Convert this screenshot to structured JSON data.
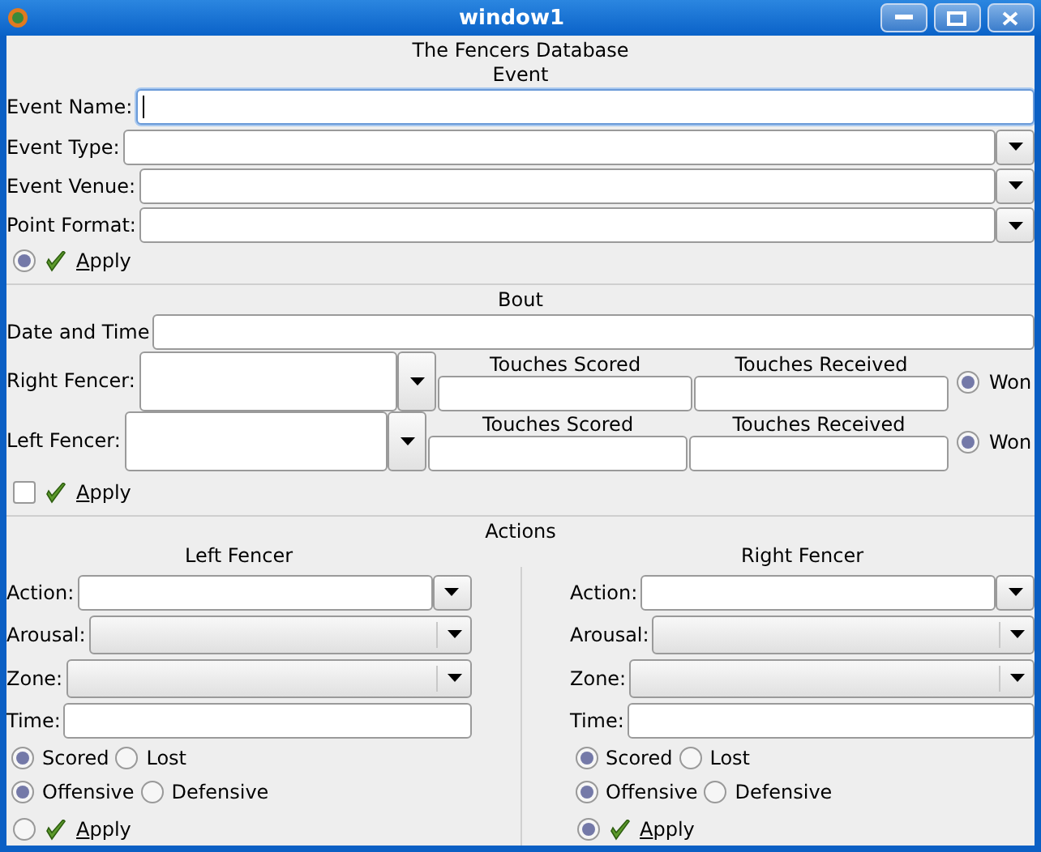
{
  "window": {
    "title": "window1"
  },
  "heading": "The Fencers Database",
  "event": {
    "title": "Event",
    "fields": [
      {
        "label": "Event Name:",
        "kind": "entry",
        "focused": true
      },
      {
        "label": "Event Type:",
        "kind": "combo-entry",
        "focused": false
      },
      {
        "label": "Event Venue:",
        "kind": "combo-entry",
        "focused": false
      },
      {
        "label": "Point Format:",
        "kind": "combo-entry",
        "focused": false
      }
    ],
    "apply": {
      "kind": "radio",
      "checked": true,
      "label": "Apply"
    }
  },
  "bout": {
    "title": "Bout",
    "date_label": "Date and Time",
    "fencers": [
      {
        "label": "Right Fencer:",
        "scored_label": "Touches Scored",
        "received_label": "Touches Received",
        "won_label": "Won",
        "won": true
      },
      {
        "label": "Left Fencer:",
        "scored_label": "Touches Scored",
        "received_label": "Touches Received",
        "won_label": "Won",
        "won": true
      }
    ],
    "apply": {
      "kind": "checkbox",
      "checked": false,
      "label": "Apply"
    }
  },
  "actions": {
    "title": "Actions",
    "sides": [
      {
        "title": "Left Fencer",
        "fields": [
          {
            "label": "Action:",
            "kind": "combo-entry"
          },
          {
            "label": "Arousal:",
            "kind": "combo"
          },
          {
            "label": "Zone:",
            "kind": "combo"
          },
          {
            "label": "Time:",
            "kind": "entry"
          }
        ],
        "result": [
          {
            "label": "Scored",
            "selected": true
          },
          {
            "label": "Lost",
            "selected": false
          }
        ],
        "style": [
          {
            "label": "Offensive",
            "selected": true
          },
          {
            "label": "Defensive",
            "selected": false
          }
        ],
        "apply": {
          "kind": "radio",
          "checked": false,
          "label": "Apply"
        }
      },
      {
        "title": "Right Fencer",
        "fields": [
          {
            "label": "Action:",
            "kind": "combo-entry"
          },
          {
            "label": "Arousal:",
            "kind": "combo"
          },
          {
            "label": "Zone:",
            "kind": "combo"
          },
          {
            "label": "Time:",
            "kind": "entry"
          }
        ],
        "result": [
          {
            "label": "Scored",
            "selected": true
          },
          {
            "label": "Lost",
            "selected": false
          }
        ],
        "style": [
          {
            "label": "Offensive",
            "selected": true
          },
          {
            "label": "Defensive",
            "selected": false
          }
        ],
        "apply": {
          "kind": "radio",
          "checked": true,
          "label": "Apply"
        }
      }
    ]
  }
}
